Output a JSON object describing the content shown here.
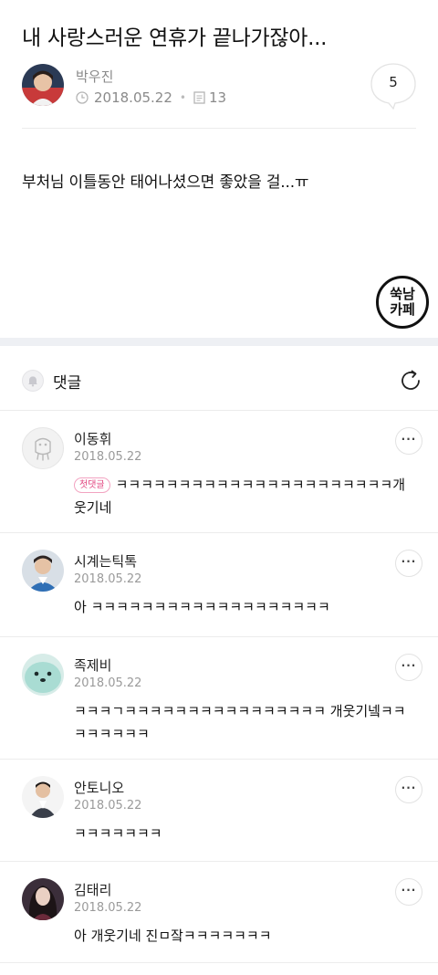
{
  "post": {
    "title": "내 사랑스러운 연휴가 끝나가잖아...",
    "author": "박우진",
    "date": "2018.05.22",
    "views": "13",
    "comment_count": "5",
    "body": "부처님 이틀동안 태어나셨으면 좋았을 걸...ㅠ",
    "watermark_line1": "쑥남",
    "watermark_line2": "카페"
  },
  "comments_section": {
    "label": "댓글"
  },
  "comments": [
    {
      "name": "이동휘",
      "date": "2018.05.22",
      "badge": "첫댓글",
      "text": "ㅋㅋㅋㅋㅋㅋㅋㅋㅋㅋㅋㅋㅋㅋㅋㅋㅋㅋㅋㅋㅋㅋ개웃기네",
      "more": "···"
    },
    {
      "name": "시계는틱톡",
      "date": "2018.05.22",
      "text": "아 ㅋㅋㅋㅋㅋㅋㅋㅋㅋㅋㅋㅋㅋㅋㅋㅋㅋㅋㅋ",
      "more": "···"
    },
    {
      "name": "족제비",
      "date": "2018.05.22",
      "text": "ㅋㅋㅋㄱㅋㅋㅋㅋㅋㅋㅋㅋㅋㅋㅋㅋㅋㅋㅋㅋ 개웃기넼ㅋㅋㅋㅋㅋㅋㅋㅋ",
      "more": "···"
    },
    {
      "name": "안토니오",
      "date": "2018.05.22",
      "text": "ㅋㅋㅋㅋㅋㅋㅋ",
      "more": "···"
    },
    {
      "name": "김태리",
      "date": "2018.05.22",
      "text": "아 개웃기네 진ㅁ잨ㅋㅋㅋㅋㅋㅋㅋ",
      "more": "···"
    }
  ],
  "icons": {
    "clock": "clock-icon",
    "document": "document-icon",
    "bell": "bell-icon",
    "refresh": "refresh-icon",
    "more": "more-icon"
  },
  "colors": {
    "meta_gray": "#8a8a8a",
    "badge_pink": "#e2457f",
    "band": "#eef0f4"
  }
}
